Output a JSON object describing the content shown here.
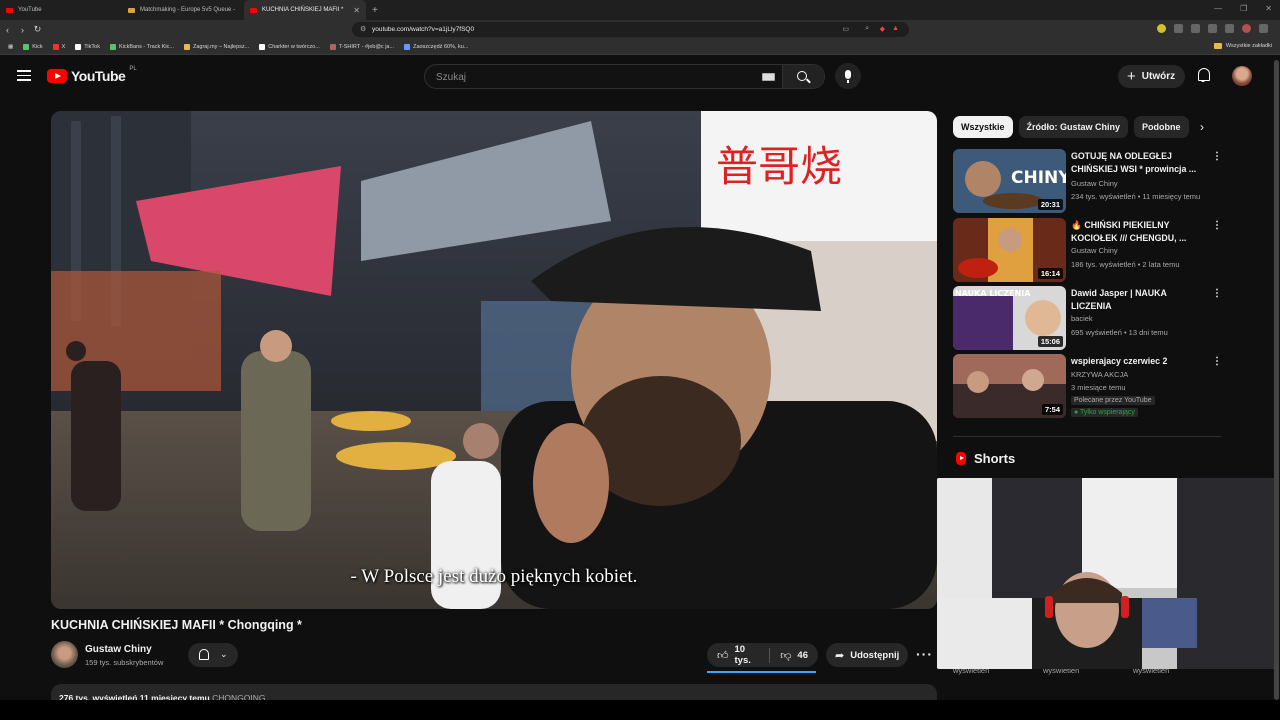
{
  "browser": {
    "tabs": [
      {
        "label": "YouTube",
        "active": false
      },
      {
        "label": "Matchmaking - Europe 5v5 Queue -",
        "active": false
      },
      {
        "label": "KUCHNIA CHIŃSKIEJ MAFII *",
        "active": true
      }
    ],
    "url": "youtube.com/watch?v=a1jLly7fSQ0",
    "bookmarks": [
      "Kick",
      "X",
      "TikTok",
      "KickBans - Track Kic...",
      "Zagraj.my – Najlepsz...",
      "Charkter w twórczo...",
      "T-SHIRT - #jeb@c ja...",
      "Zaoszczędź 60%, ku..."
    ],
    "all_bookmarks": "Wszystkie zakładki"
  },
  "masthead": {
    "logo_text": "YouTube",
    "country": "PL",
    "search_placeholder": "Szukaj",
    "create_label": "Utwórz"
  },
  "video": {
    "subtitle": "- W Polsce jest dużo pięknych kobiet.",
    "title": "KUCHNIA CHIŃSKIEJ MAFII * Chongqing *",
    "channel": "Gustaw Chiny",
    "subscribers": "159 tys. subskrybentów",
    "likes": "10 tys.",
    "dislikes": "46",
    "share_label": "Udostępnij",
    "description_stats": "276 tys. wyświetleń 11 miesięcy temu",
    "description_tag": "CHONGQING"
  },
  "sidebar": {
    "chips": [
      {
        "label": "Wszystkie",
        "active": true
      },
      {
        "label": "Źródło: Gustaw Chiny",
        "active": false
      },
      {
        "label": "Podobne",
        "active": false
      }
    ],
    "recommendations": [
      {
        "title": "GOTUJĘ NA ODLEGŁEJ CHIŃSKIEJ WSI * prowincja ...",
        "channel": "Gustaw Chiny",
        "meta": "234 tys. wyświetleń • 11 miesięcy temu",
        "duration": "20:31",
        "thumb_text": "CHINY"
      },
      {
        "title": "🔥 CHIŃSKI PIEKIELNY KOCIOŁEK /// CHENGDU, ...",
        "channel": "Gustaw Chiny",
        "meta": "186 tys. wyświetleń • 2 lata temu",
        "duration": "16:14",
        "thumb_text": ""
      },
      {
        "title": "Dawid Jasper | NAUKA LICZENIA",
        "channel": "baciek",
        "meta": "695 wyświetleń • 13 dni temu",
        "duration": "15:06",
        "thumb_text": "NAUKA LICZENIA"
      },
      {
        "title": "wspierajacy czerwiec 2",
        "channel": "KRZYWA AKCJA",
        "meta": "3 miesiące temu",
        "duration": "7:54",
        "badge": "Polecane przez YouTube",
        "badge2": "Tylko wspierający"
      }
    ],
    "shorts_label": "Shorts",
    "short_views": [
      "wyświetleń",
      "wyświetleń",
      "wyświetleń"
    ]
  }
}
